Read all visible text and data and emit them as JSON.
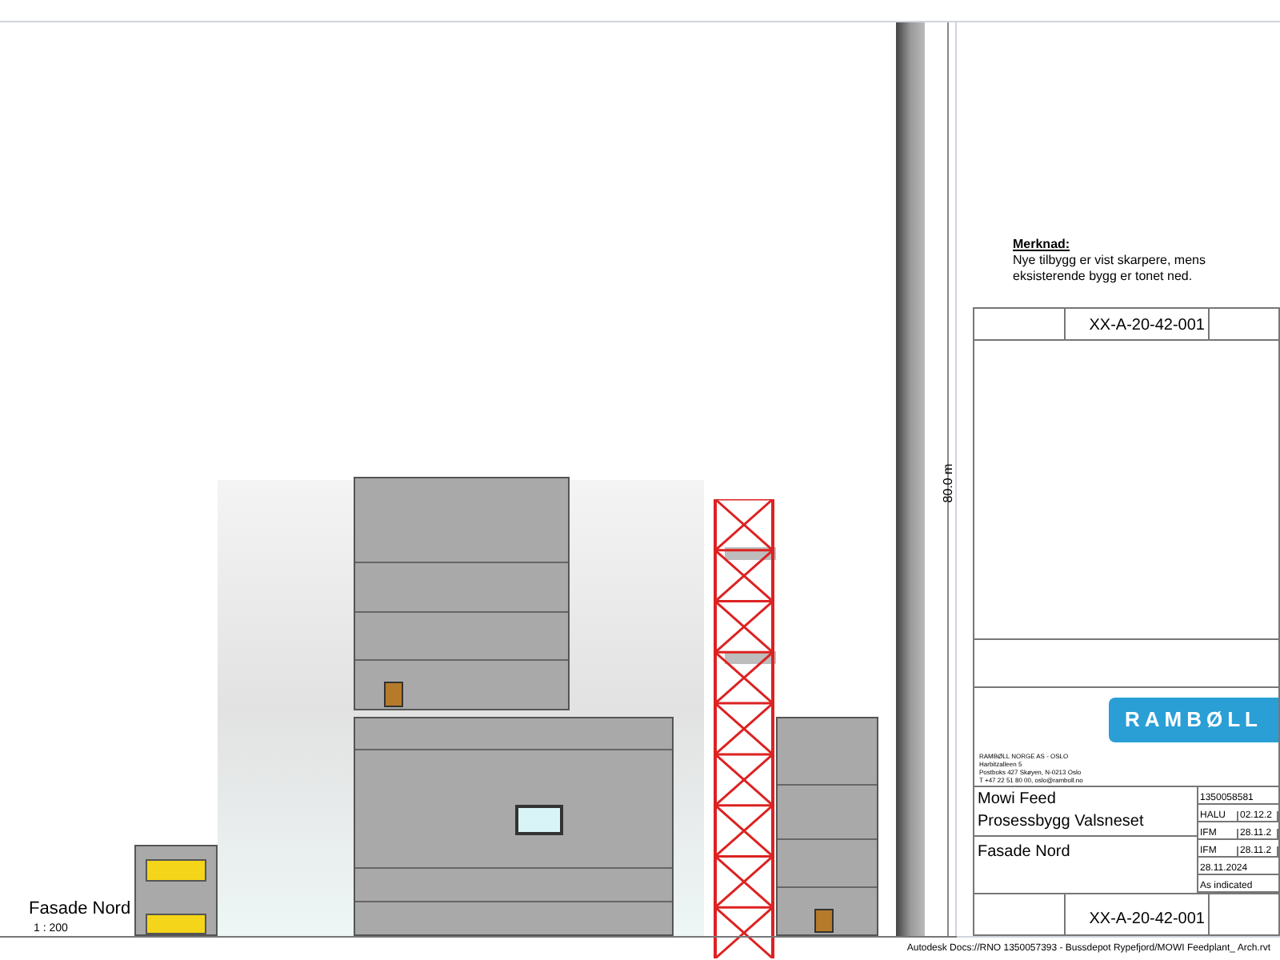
{
  "drawing": {
    "view_title": "Fasade Nord",
    "scale": "1 : 200",
    "dimension": "80.0 m"
  },
  "note": {
    "title": "Merknad:",
    "text": "Nye tilbygg er vist skarpere, mens eksisterende bygg er tonet ned."
  },
  "title_block": {
    "top_sheet_number": "XX-A-20-42-001",
    "logo": "RAMBØLL",
    "address": [
      "RAMBØLL NORGE AS - OSLO",
      "Harbitzalleen 5",
      "Postboks 427 Skøyen, N-0213 Oslo",
      "T +47 22 51 80 00, oslo@ramboll.no"
    ],
    "project": [
      "Mowi Feed",
      "Prosessbygg Valsneset"
    ],
    "view_name": "Fasade Nord",
    "fields": [
      {
        "values": [
          "1350058581"
        ]
      },
      {
        "values": [
          "HALU",
          "02.12.2"
        ]
      },
      {
        "values": [
          "IFM",
          "28.11.2"
        ]
      },
      {
        "values": [
          "IFM",
          "28.11.2"
        ]
      },
      {
        "values": [
          "28.11.2024"
        ]
      },
      {
        "values": [
          "As indicated"
        ]
      }
    ],
    "sheet_number": "XX-A-20-42-001"
  },
  "footer": "Autodesk Docs://RNO 1350057393 - Bussdepot Rypefjord/MOWI Feedplant_ Arch.rvt"
}
